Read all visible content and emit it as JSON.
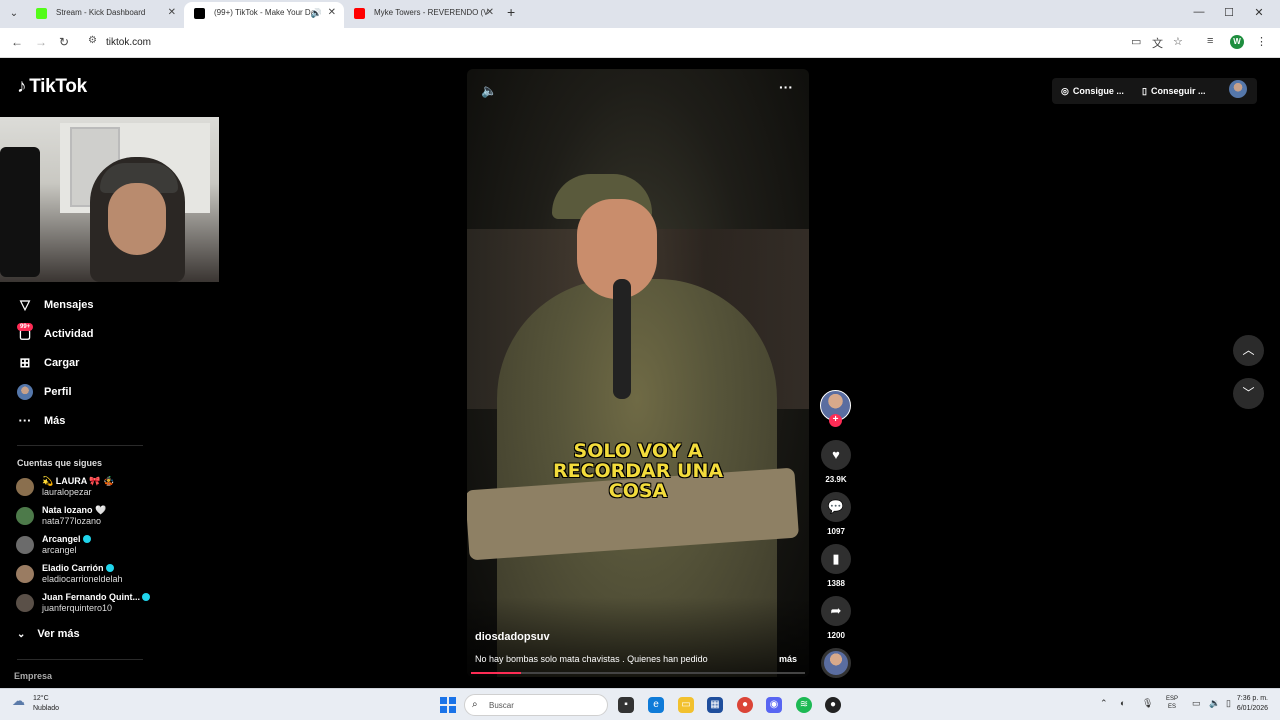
{
  "browser": {
    "tabs": [
      {
        "title": "Stream - Kick Dashboard",
        "favicon_color": "#53fc18"
      },
      {
        "title": "(99+) TikTok - Make Your Da",
        "favicon_color": "#000000"
      },
      {
        "title": "Myke Towers - REVERENDO (V",
        "favicon_color": "#ff0000"
      }
    ],
    "new_tab": "+",
    "url": "tiktok.com",
    "profile_initial": "W"
  },
  "sidebar": {
    "logo": "TikTok",
    "nav": [
      {
        "label": "Mensajes",
        "icon": "send-icon"
      },
      {
        "label": "Actividad",
        "icon": "inbox-icon"
      },
      {
        "label": "Cargar",
        "icon": "upload-icon"
      },
      {
        "label": "Perfil",
        "icon": "profile-icon"
      },
      {
        "label": "Más",
        "icon": "more-icon"
      }
    ],
    "activity_badge": "99+",
    "following_title": "Cuentas que sigues",
    "accounts": [
      {
        "name": "💫 LAURA 🎀 🤹",
        "handle": "lauralopezar",
        "verified": false
      },
      {
        "name": "Nata lozano 🤍",
        "handle": "nata777lozano",
        "verified": false
      },
      {
        "name": "Arcangel",
        "handle": "arcangel",
        "verified": true
      },
      {
        "name": "Eladio Carrión",
        "handle": "eladiocarrioneldelah",
        "verified": true
      },
      {
        "name": "Juan Fernando Quint...",
        "handle": "juanferquintero10",
        "verified": true
      }
    ],
    "see_more": "Ver más",
    "footer": "Empresa"
  },
  "video": {
    "caption_lines": [
      "SOLO VOY A",
      "RECORDAR UNA",
      "COSA"
    ],
    "author": "diosdadopsuv",
    "description": "No hay bombas solo mata  chavistas . Quienes han pedido",
    "more": "más",
    "progress": 0.15
  },
  "actions": {
    "likes": "23.9K",
    "comments": "1097",
    "saves": "1388",
    "shares": "1200"
  },
  "header": {
    "get_coins": "Consigue ...",
    "get_app": "Conseguir ..."
  },
  "taskbar": {
    "temp": "12°C",
    "weather": "Nublado",
    "search_placeholder": "Buscar",
    "lang_top": "ESP",
    "lang_bottom": "ES",
    "time": "7:36 p. m.",
    "date": "6/01/2026"
  }
}
